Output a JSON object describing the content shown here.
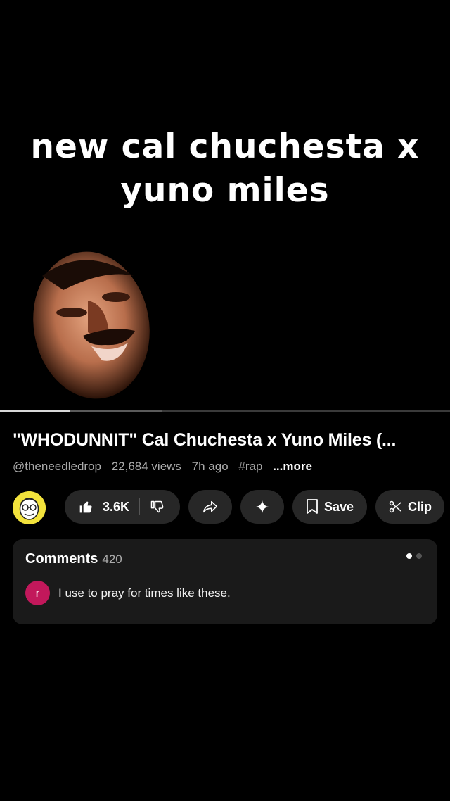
{
  "video": {
    "overlay_line1": "new cal chuchesta x",
    "overlay_line2": "yuno miles",
    "progress_played": 0.156,
    "progress_buffered": 0.36
  },
  "title": "\"WHODUNNIT\" Cal Chuchesta x Yuno Miles (...",
  "meta": {
    "channel": "@theneedledrop",
    "views": "22,684 views",
    "age": "7h ago",
    "hashtag": "#rap",
    "more": "...more"
  },
  "actions": {
    "like_count": "3.6K",
    "save_label": "Save",
    "clip_label": "Clip",
    "icons": [
      "thumbs-up-icon",
      "thumbs-down-icon",
      "share-icon",
      "sparkle-icon",
      "bookmark-icon",
      "scissors-icon"
    ]
  },
  "comments": {
    "heading": "Comments",
    "count": "420",
    "top_comment": {
      "avatar_letter": "r",
      "text": "I use to pray for times like these."
    }
  },
  "colors": {
    "background": "#000000",
    "pill": "#272727",
    "panel": "#1a1a1a",
    "avatar_channel": "#f3e33c",
    "avatar_commenter": "#c2185b"
  }
}
